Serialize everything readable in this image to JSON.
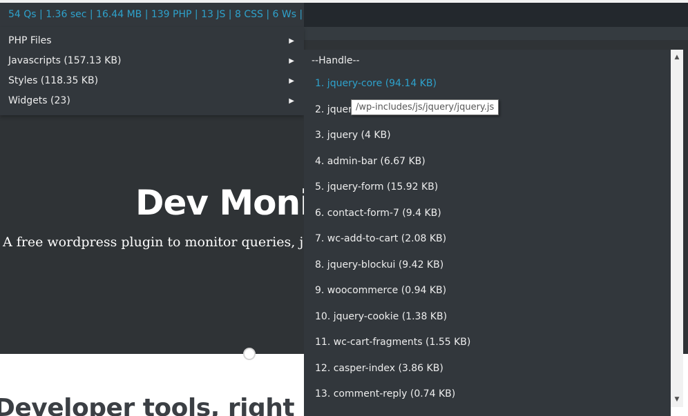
{
  "hero": {
    "title": "Dev Moni",
    "subtitle": "A free wordpress plugin to monitor queries, ja",
    "below_heading": "Developer tools, right in your admin"
  },
  "stats_bar": {
    "text": "54 Qs | 1.36 sec | 16.44 MB | 139 PHP | 13 JS | 8 CSS | 6 Ws |"
  },
  "menu": {
    "items": [
      {
        "label": "PHP Files"
      },
      {
        "label": "Javascripts (157.13 KB)"
      },
      {
        "label": "Styles (118.35 KB)"
      },
      {
        "label": "Widgets (23)"
      }
    ],
    "arrow": "▶"
  },
  "submenu": {
    "header": "--Handle--",
    "items": [
      {
        "label": "1. jquery-core (94.14 KB)"
      },
      {
        "label": "2. jquer"
      },
      {
        "label": "3. jquery (4 KB)"
      },
      {
        "label": "4. admin-bar (6.67 KB)"
      },
      {
        "label": "5. jquery-form (15.92 KB)"
      },
      {
        "label": "6. contact-form-7 (9.4 KB)"
      },
      {
        "label": "7. wc-add-to-cart (2.08 KB)"
      },
      {
        "label": "8. jquery-blockui (9.42 KB)"
      },
      {
        "label": "9. woocommerce (0.94 KB)"
      },
      {
        "label": "10. jquery-cookie (1.38 KB)"
      },
      {
        "label": "11. wc-cart-fragments (1.55 KB)"
      },
      {
        "label": "12. casper-index (3.86 KB)"
      },
      {
        "label": "13. comment-reply (0.74 KB)"
      }
    ]
  },
  "tooltip": {
    "text": "/wp-includes/js/jquery/jquery.js"
  },
  "scrollbar": {
    "up": "▲",
    "down": "▼"
  },
  "colors": {
    "link_accent": "#2ea2cc",
    "panel_bg": "#32373c",
    "admin_bar_bg": "#23282d"
  }
}
